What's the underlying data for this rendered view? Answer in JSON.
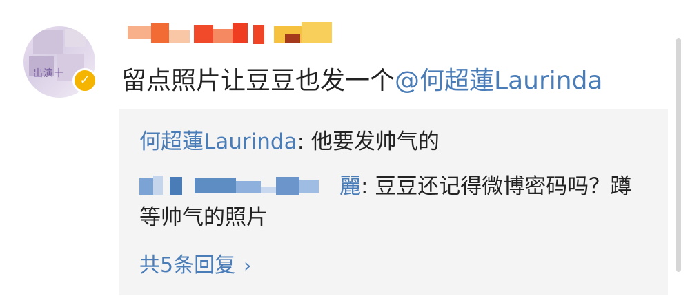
{
  "comment": {
    "avatar_caption": "出演十",
    "text": "留点照片让豆豆也发一个",
    "mention": "@何超蓮Laurinda"
  },
  "replies": [
    {
      "author": "何超蓮Laurinda",
      "text": ": 他要发帅气的"
    },
    {
      "author_visible_suffix": "麗",
      "text": ": 豆豆还记得微博密码吗？蹲等帅气的照片"
    }
  ],
  "more_replies": {
    "label": "共5条回复",
    "chevron": "›"
  },
  "colors": {
    "link": "#4a7db8",
    "text": "#222222",
    "reply_bg": "#f4f4f4",
    "verified": "#f5b400"
  },
  "icons": [
    "verified-badge-icon",
    "chevron-right-icon"
  ]
}
